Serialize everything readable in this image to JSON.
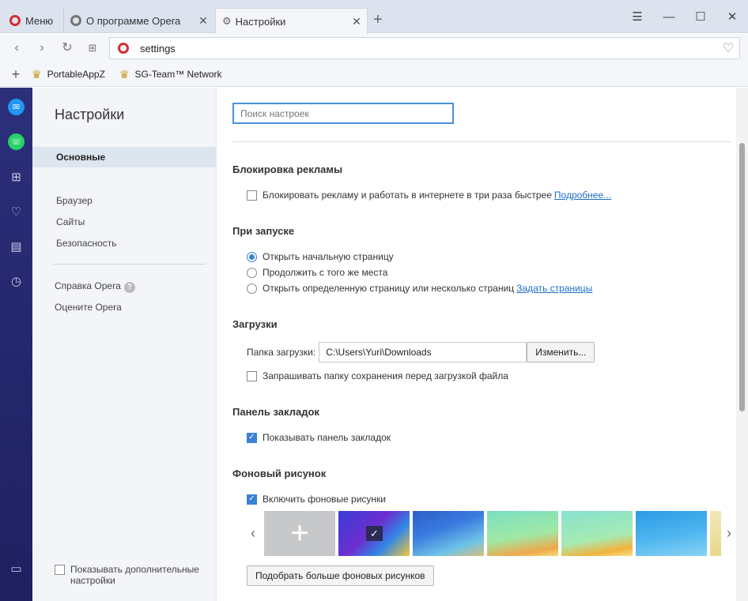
{
  "tabs": {
    "menu_label": "Меню",
    "about_title": "О программе Opera",
    "settings_title": "Настройки"
  },
  "addressbar": {
    "url": "settings"
  },
  "bookmarks": [
    {
      "label": "PortableAppZ"
    },
    {
      "label": "SG-Team™ Network"
    }
  ],
  "nav": {
    "title": "Настройки",
    "items": [
      {
        "label": "Основные",
        "active": true
      },
      {
        "label": "Браузер"
      },
      {
        "label": "Сайты"
      },
      {
        "label": "Безопасность"
      }
    ],
    "help_label": "Справка Opera",
    "rate_label": "Оцените Opera",
    "advanced_label": "Показывать дополнительные настройки"
  },
  "content": {
    "search_placeholder": "Поиск настроек",
    "adblock": {
      "title": "Блокировка рекламы",
      "checkbox_label": "Блокировать рекламу и работать в интернете в три раза быстрее",
      "link": "Подробнее..."
    },
    "startup": {
      "title": "При запуске",
      "options": [
        {
          "label": "Открыть начальную страницу",
          "checked": true
        },
        {
          "label": "Продолжить с того же места"
        },
        {
          "label": "Открыть определенную страницу или несколько страниц"
        }
      ],
      "link": "Задать страницы"
    },
    "downloads": {
      "title": "Загрузки",
      "folder_label": "Папка загрузки:",
      "folder_value": "C:\\Users\\Yuri\\Downloads",
      "change_button": "Изменить...",
      "ask_label": "Запрашивать папку сохранения перед загрузкой файла"
    },
    "bookmarks_bar": {
      "title": "Панель закладок",
      "show_label": "Показывать панель закладок"
    },
    "wallpaper": {
      "title": "Фоновый рисунок",
      "enable_label": "Включить фоновые рисунки",
      "more_button": "Подобрать больше фоновых рисунков"
    }
  },
  "colors": {
    "sidebar": "#2c2f7a",
    "accent": "#3b82d6",
    "link": "#1f6fc8",
    "opera_red": "#d32f2f"
  }
}
